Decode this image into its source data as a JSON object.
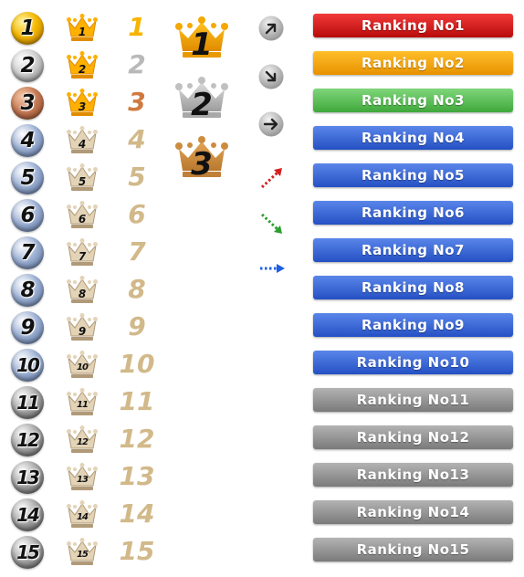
{
  "colors": {
    "red": "#d11010",
    "orange": "#f5a000",
    "green": "#4fbf4c",
    "blue": "#2f62d8",
    "gray": "#8e8e8e",
    "gold": "#f6b400",
    "silver": "#b9b9b9",
    "bronze": "#d07a40",
    "beige": "#d2b98a"
  },
  "rows": [
    {
      "rank": "1",
      "big": "1",
      "label": "Ranking No1"
    },
    {
      "rank": "2",
      "big": "2",
      "label": "Ranking No2"
    },
    {
      "rank": "3",
      "big": "3",
      "label": "Ranking No3"
    },
    {
      "rank": "4",
      "big": "4",
      "label": "Ranking No4"
    },
    {
      "rank": "5",
      "big": "5",
      "label": "Ranking No5"
    },
    {
      "rank": "6",
      "big": "6",
      "label": "Ranking No6"
    },
    {
      "rank": "7",
      "big": "7",
      "label": "Ranking No7"
    },
    {
      "rank": "8",
      "big": "8",
      "label": "Ranking No8"
    },
    {
      "rank": "9",
      "big": "9",
      "label": "Ranking No9"
    },
    {
      "rank": "10",
      "big": "10",
      "label": "Ranking No10"
    },
    {
      "rank": "11",
      "big": "11",
      "label": "Ranking No11"
    },
    {
      "rank": "12",
      "big": "12",
      "label": "Ranking No12"
    },
    {
      "rank": "13",
      "big": "13",
      "label": "Ranking No13"
    },
    {
      "rank": "14",
      "big": "14",
      "label": "Ranking No14"
    },
    {
      "rank": "15",
      "big": "15",
      "label": "Ranking No15"
    }
  ],
  "big_crowns": [
    "1",
    "2",
    "3"
  ],
  "trend_icons": [
    "arrow-up-right-icon",
    "arrow-down-right-icon",
    "arrow-right-icon"
  ],
  "dotted_arrows": [
    "dotted-arrow-up-icon",
    "dotted-arrow-down-icon",
    "dotted-arrow-right-icon"
  ]
}
